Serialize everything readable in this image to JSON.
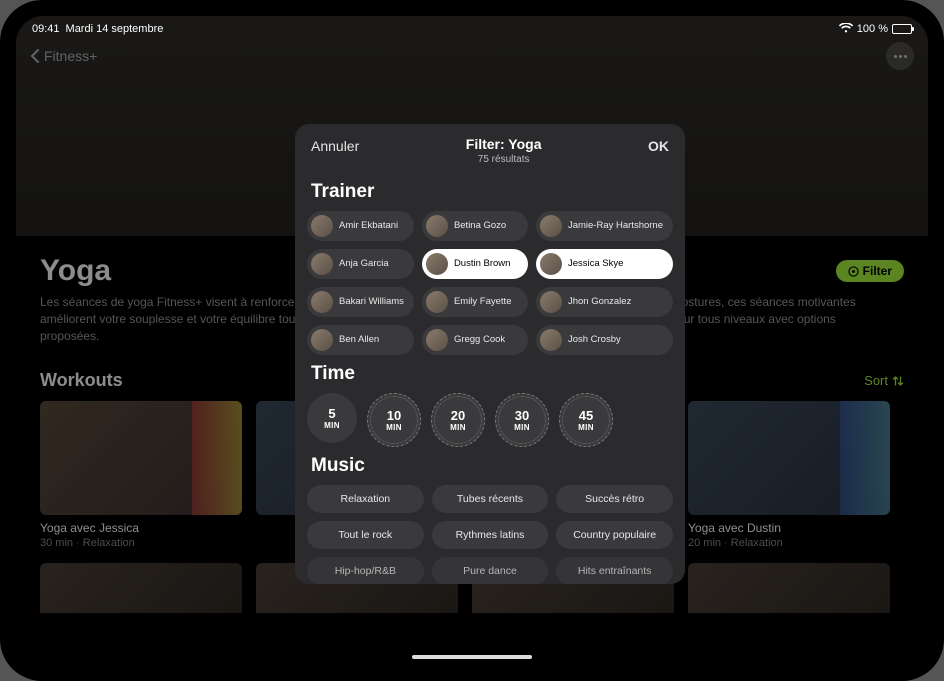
{
  "statusbar": {
    "time": "09:41",
    "date": "Mardi 14 septembre",
    "battery_pct": "100 %"
  },
  "nav": {
    "back_label": "Fitness+"
  },
  "page": {
    "title": "Yoga",
    "description": "Les séances de yoga Fitness+ visent à renforcer votre corps et à apaiser votre esprit. Composées d'enchaînements de postures, ces séances motivantes améliorent votre souplesse et votre équilibre tout en vous aidant à prendre conscience en se basant sur la respiration. Pour tous niveaux avec options proposées.",
    "filter_button": "Filter",
    "workouts_label": "Workouts",
    "sort_label": "Sort"
  },
  "workouts": [
    {
      "name": "Yoga avec Jessica",
      "meta": "30 min · Relaxation"
    },
    {
      "name": "",
      "meta": ""
    },
    {
      "name": "",
      "meta": ""
    },
    {
      "name": "Yoga avec Dustin",
      "meta": "20 min · Relaxation"
    }
  ],
  "modal": {
    "cancel": "Annuler",
    "ok": "OK",
    "title": "Filter: Yoga",
    "subtitle": "75 résultats",
    "trainer_label": "Trainer",
    "time_label": "Time",
    "music_label": "Music",
    "trainers": [
      {
        "name": "Amir Ekbatani",
        "selected": false
      },
      {
        "name": "Betina Gozo",
        "selected": false
      },
      {
        "name": "Jamie-Ray Hartshorne",
        "selected": false
      },
      {
        "name": "Anja Garcia",
        "selected": false
      },
      {
        "name": "Dustin Brown",
        "selected": true
      },
      {
        "name": "Jessica Skye",
        "selected": true
      },
      {
        "name": "Bakari Williams",
        "selected": false
      },
      {
        "name": "Emily Fayette",
        "selected": false
      },
      {
        "name": "Jhon Gonzalez",
        "selected": false
      },
      {
        "name": "Ben Allen",
        "selected": false
      },
      {
        "name": "Gregg Cook",
        "selected": false
      },
      {
        "name": "Josh Crosby",
        "selected": false
      }
    ],
    "times": [
      {
        "num": "5",
        "unit": "MIN"
      },
      {
        "num": "10",
        "unit": "MIN"
      },
      {
        "num": "20",
        "unit": "MIN"
      },
      {
        "num": "30",
        "unit": "MIN"
      },
      {
        "num": "45",
        "unit": "MIN"
      }
    ],
    "music": [
      "Relaxation",
      "Tubes récents",
      "Succès rétro",
      "Tout le rock",
      "Rythmes latins",
      "Country populaire",
      "Hip-hop/R&B",
      "Pure dance",
      "Hits entraînants"
    ]
  }
}
